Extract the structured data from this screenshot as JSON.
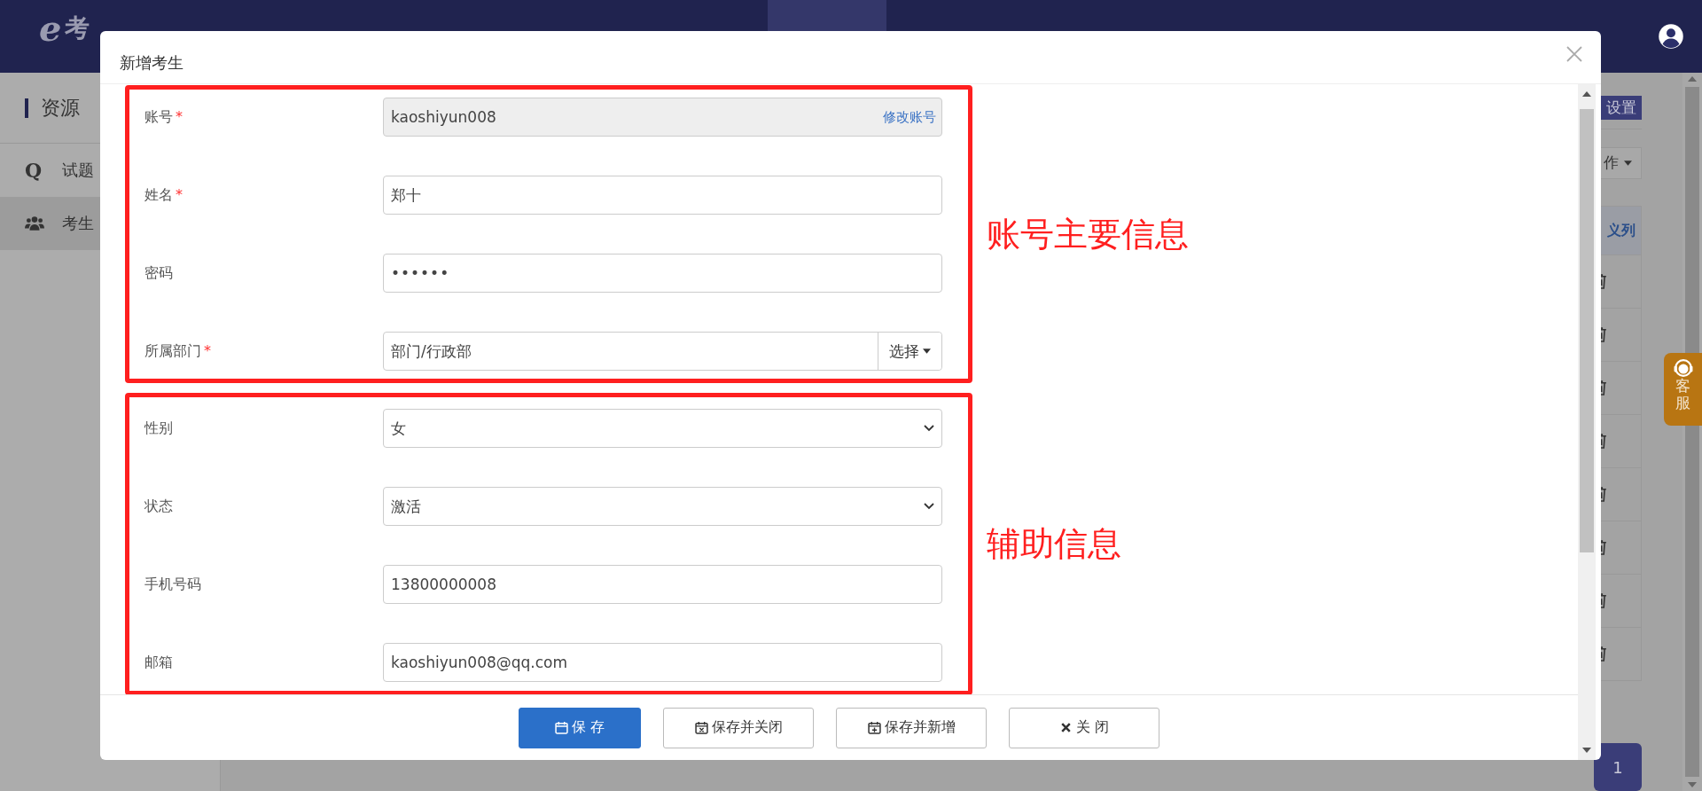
{
  "nav": {
    "logo_letter": "e",
    "logo_text": "考"
  },
  "sidebar": {
    "title": "资源",
    "items": [
      {
        "kind": "glyph",
        "glyph": "Q",
        "label": "试题",
        "selected": false
      },
      {
        "kind": "users",
        "label": "考生",
        "selected": true
      }
    ]
  },
  "page": {
    "settings_button": "设置",
    "actions_dropdown": "作",
    "table_header": "义列",
    "pages": [
      {
        "label": "1",
        "selected": true
      }
    ]
  },
  "support_tab": "客服",
  "dialog": {
    "title": "新增考生",
    "groups": [
      {
        "annotation": "账号主要信息",
        "fields": [
          {
            "label": "账号",
            "required_mark": "*",
            "kind": "readonly",
            "value": "kaoshiyun008",
            "link": "修改账号"
          },
          {
            "label": "姓名",
            "required_mark": "*",
            "kind": "text",
            "value": "郑十"
          },
          {
            "label": "密码",
            "kind": "password",
            "value": "••••••"
          },
          {
            "label": "所属部门",
            "required_mark": "*",
            "kind": "picker",
            "value": "部门/行政部",
            "button": "选择"
          }
        ]
      },
      {
        "annotation": "辅助信息",
        "fields": [
          {
            "label": "性别",
            "kind": "select",
            "value": "女"
          },
          {
            "label": "状态",
            "kind": "select",
            "value": "激活"
          },
          {
            "label": "手机号码",
            "kind": "text",
            "value": "13800000008"
          },
          {
            "label": "邮箱",
            "kind": "text",
            "value": "kaoshiyun008@qq.com"
          }
        ]
      }
    ],
    "buttons": [
      {
        "kind": "save",
        "primary": true,
        "label": "保 存"
      },
      {
        "kind": "save-close",
        "primary": false,
        "label": "保存并关闭"
      },
      {
        "kind": "save-new",
        "primary": false,
        "label": "保存并新增"
      },
      {
        "kind": "close",
        "primary": false,
        "label": "关 闭"
      }
    ]
  }
}
